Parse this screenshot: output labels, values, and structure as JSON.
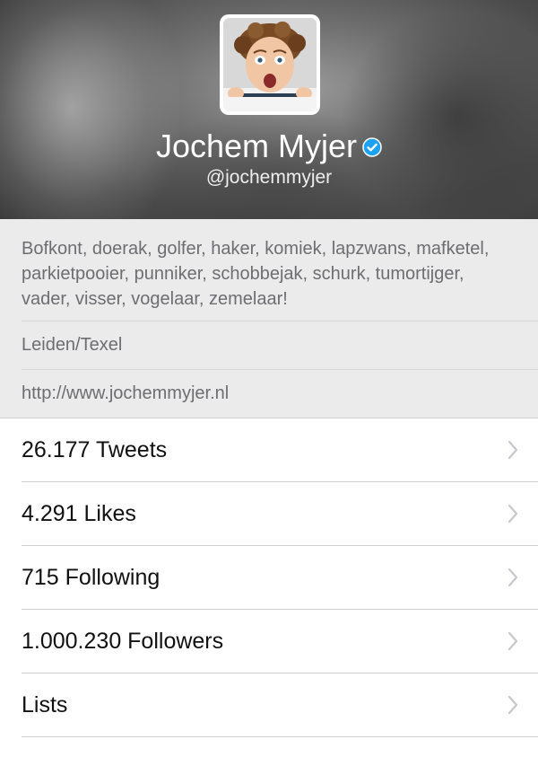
{
  "profile": {
    "name": "Jochem Myjer",
    "handle": "@jochemmyjer",
    "verified": true,
    "bio": "Bofkont, doerak, golfer, haker, komiek, lapzwans, mafketel, parkietpooier, punniker, schobbejak, schurk, tumortijger, vader, visser, vogelaar, zemelaar!",
    "location": "Leiden/Texel",
    "url": "http://www.jochemmyjer.nl"
  },
  "stats": [
    {
      "label": "26.177 Tweets"
    },
    {
      "label": "4.291 Likes"
    },
    {
      "label": "715 Following"
    },
    {
      "label": "1.000.230 Followers"
    },
    {
      "label": "Lists"
    }
  ],
  "colors": {
    "verified_badge": "#1da1f2",
    "secondary_text": "#6d6d72",
    "info_background": "#ebebeb"
  },
  "icons": {
    "verified": "verified-badge-icon",
    "row_chevron": "chevron-right-icon"
  }
}
